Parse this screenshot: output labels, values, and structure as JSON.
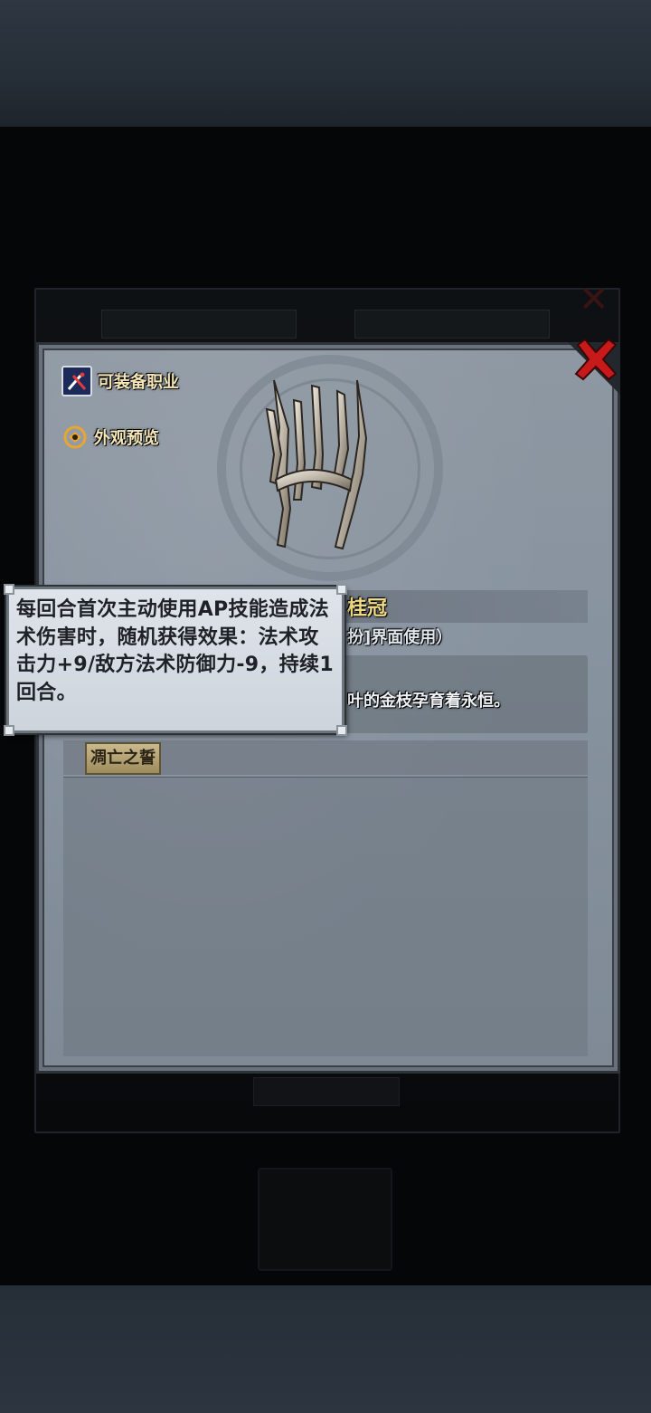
{
  "panel": {
    "options": [
      {
        "label": "可装备职业",
        "icon": "class-swords-icon"
      },
      {
        "label": "外观预览",
        "icon": "preview-icon"
      }
    ],
    "close_icon": "close-icon"
  },
  "item": {
    "title": "桂冠",
    "subtitle": "扮]界面使用）",
    "description": "叶的金枝孕育着永恒。",
    "skill_tag": "凋亡之誓"
  },
  "tooltip": {
    "text": "每回合首次主动使用AP技能造成法术伤害时，随机获得效果：法术攻击力+9/敌方法术防御力-9，持续1回合。"
  },
  "colors": {
    "title_gold": "#f1dc86",
    "close_red": "#c8191b",
    "panel_gray": "#8893a0"
  }
}
